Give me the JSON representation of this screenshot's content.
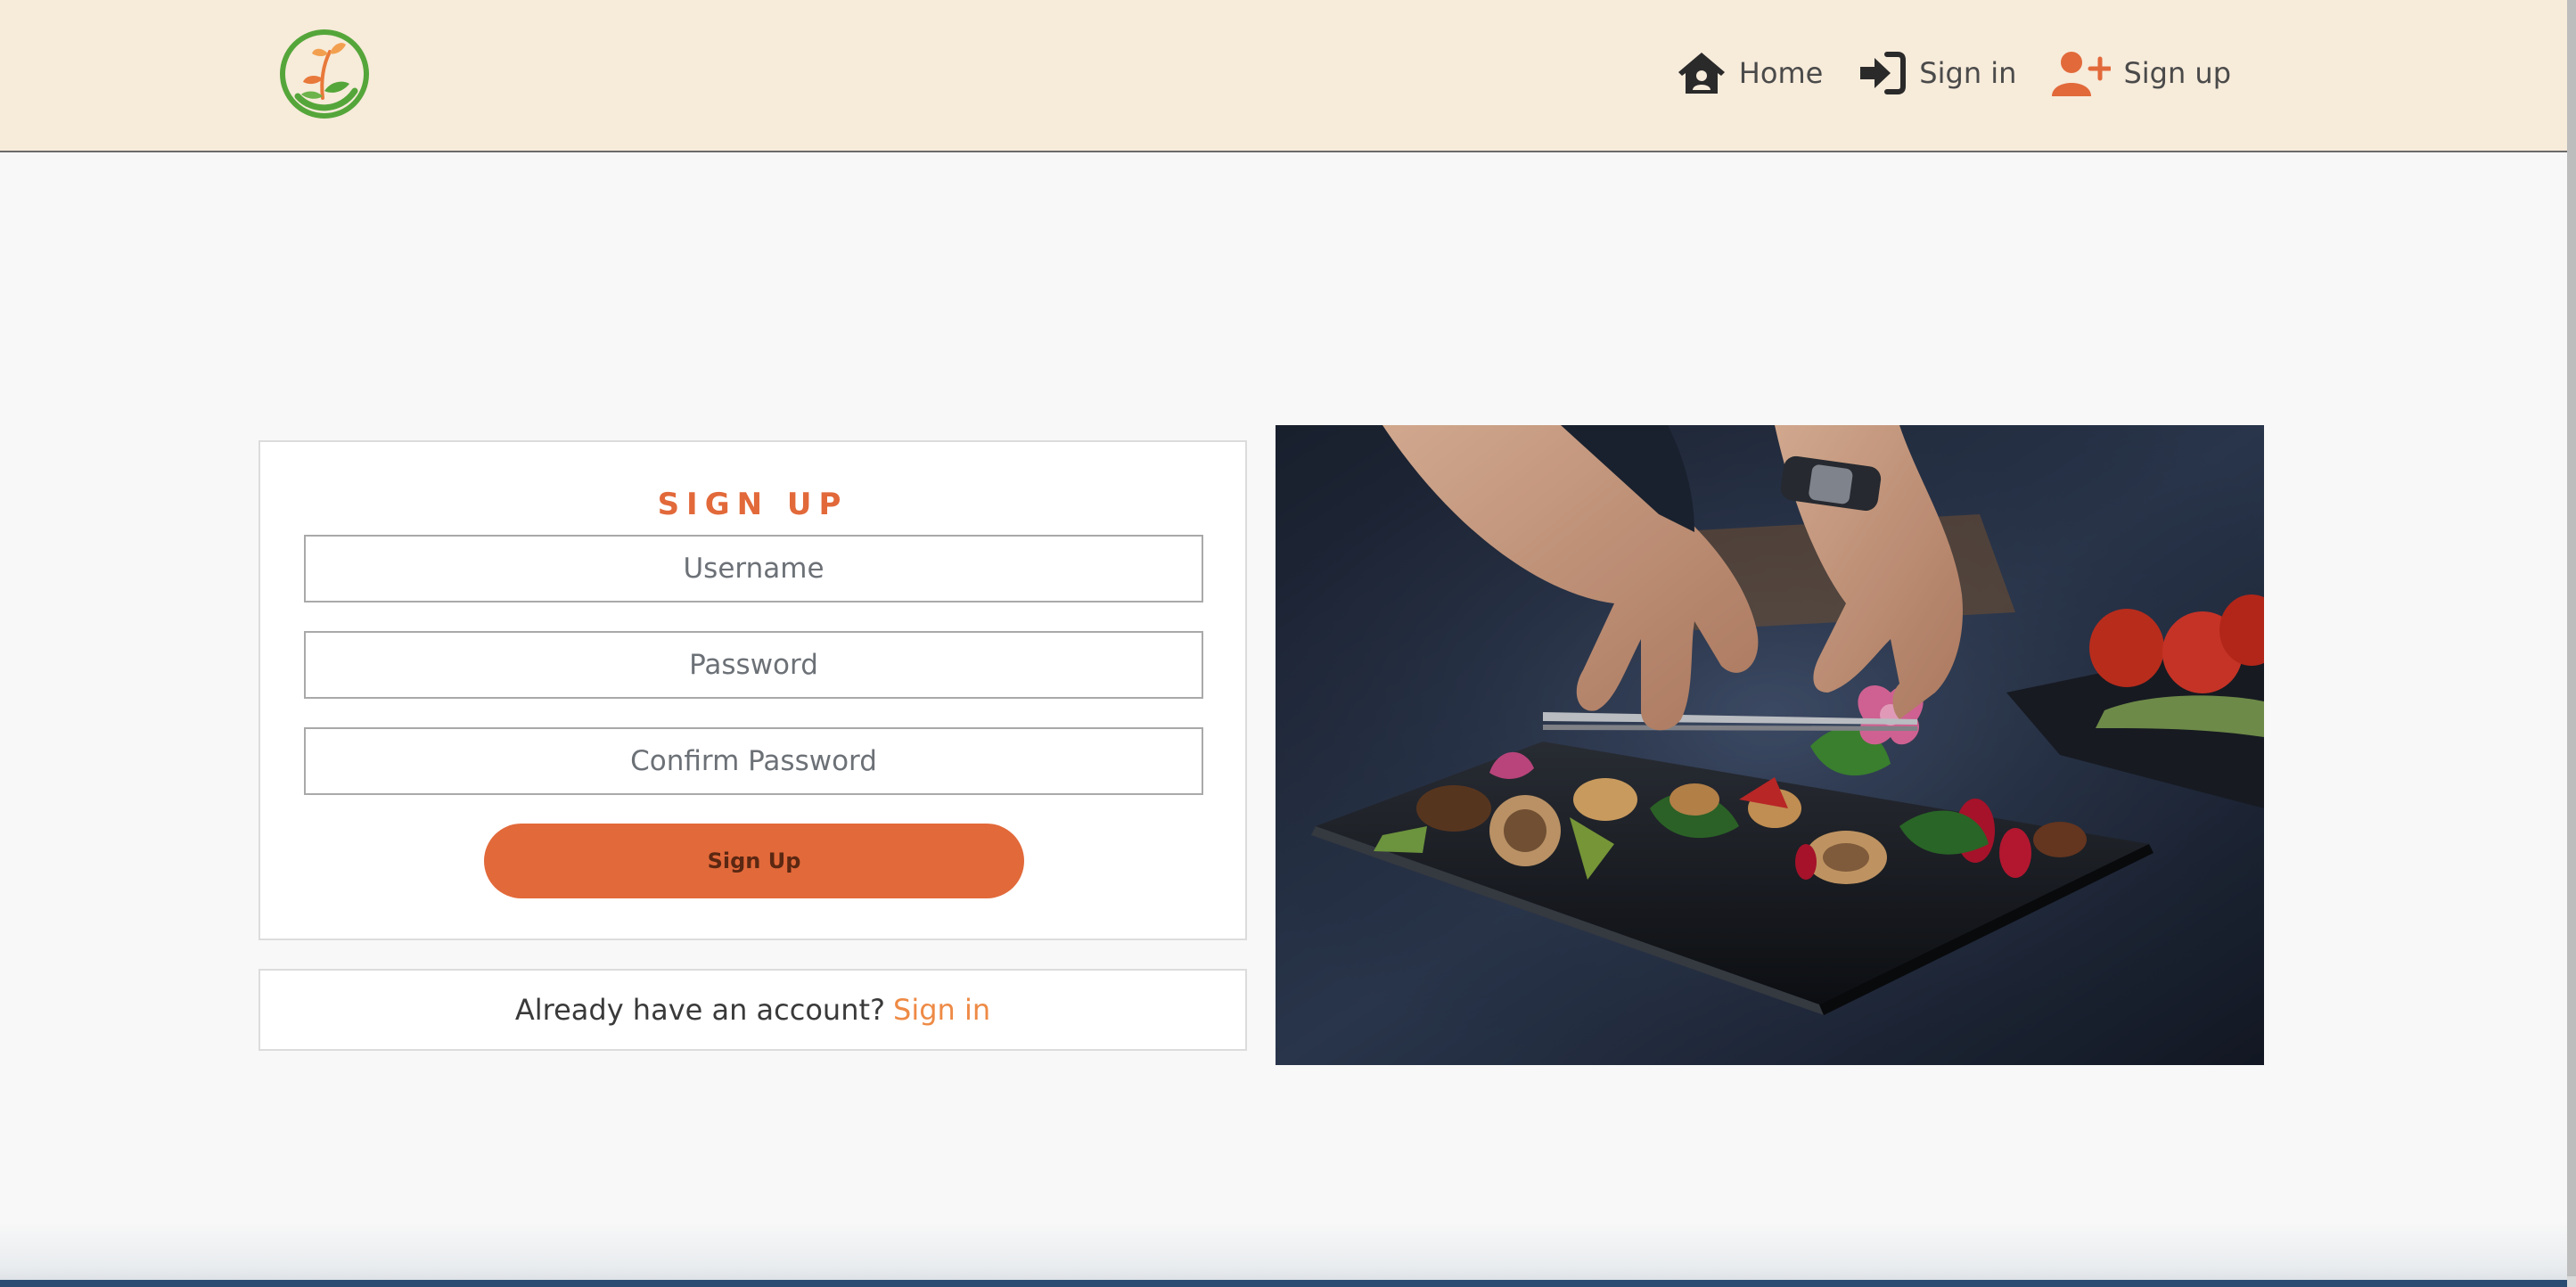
{
  "brand": {
    "logo_icon": "sprout-leaf-logo-icon",
    "colors": {
      "nav_bg": "#f7ebda",
      "accent": "#e2693a",
      "link": "#ee8a45"
    }
  },
  "nav": {
    "home_label": "Home",
    "signin_label": "Sign in",
    "signup_label": "Sign up",
    "icons": {
      "home": "house-user-icon",
      "signin": "sign-in-arrow-icon",
      "signup": "user-plus-icon"
    }
  },
  "form": {
    "title": "SIGN UP",
    "username_placeholder": "Username",
    "password_placeholder": "Password",
    "confirm_placeholder": "Confirm Password",
    "submit_label": "Sign Up"
  },
  "account": {
    "prompt": "Already have an account?",
    "signin_link": "Sign in"
  },
  "photo": {
    "subject": "chef plating salad with tweezers"
  }
}
